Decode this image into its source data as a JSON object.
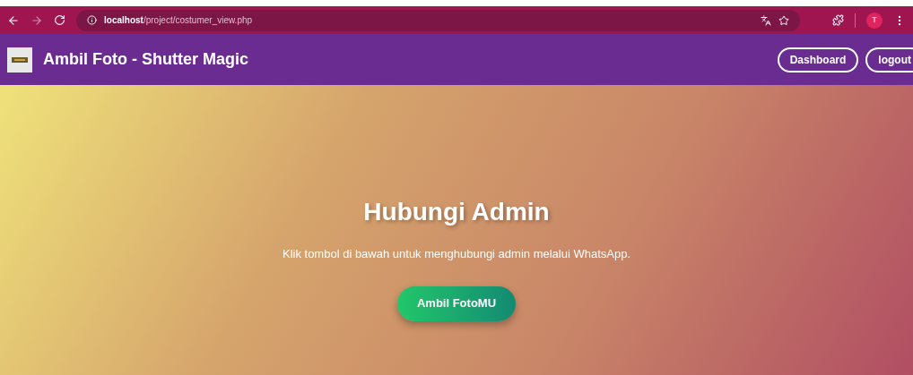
{
  "browser": {
    "url": "**localhost**/project/costumer_view.php",
    "profile": "T"
  },
  "navbar": {
    "title": "Ambil Foto - Shutter Magic",
    "buttons": [
      "Dashboard",
      "logout"
    ]
  },
  "hero": {
    "heading": "Hubungi Admin",
    "text": "Klik tombol di bawah untuk menghubungi admin melalui WhatsApp.",
    "button": "Ambil FotoMU"
  }
}
